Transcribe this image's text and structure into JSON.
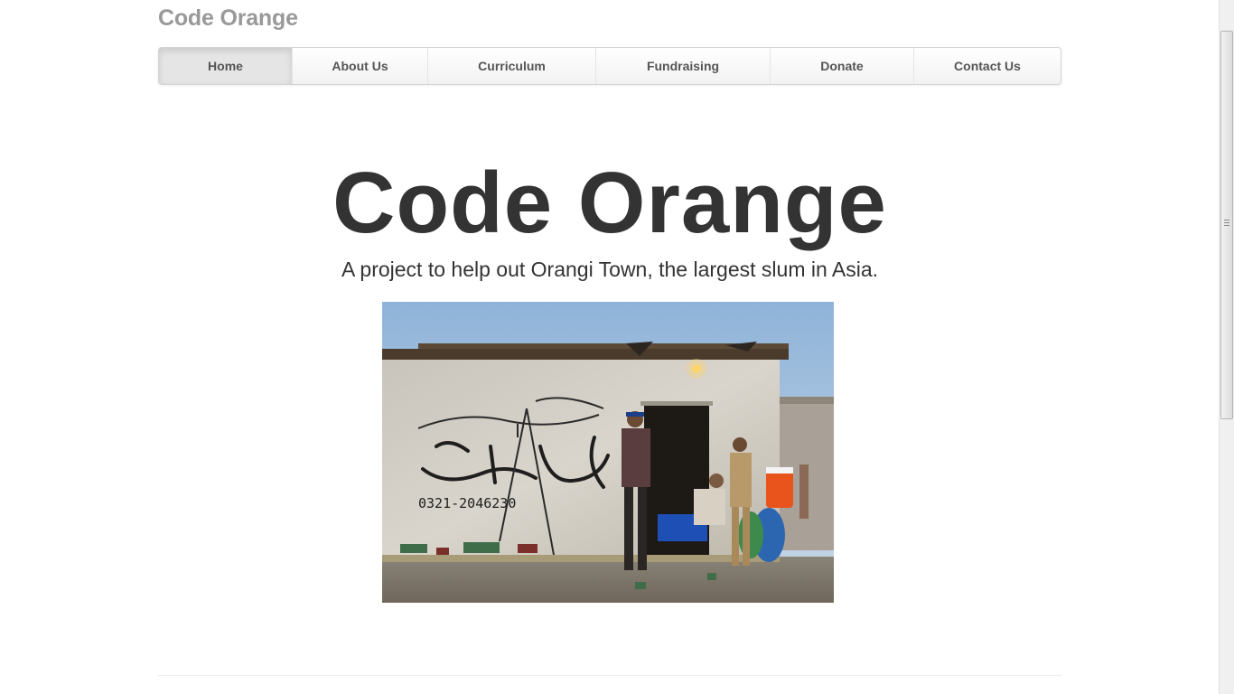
{
  "brand": {
    "title": "Code Orange"
  },
  "nav": {
    "items": [
      {
        "label": "Home",
        "active": true
      },
      {
        "label": "About Us",
        "active": false
      },
      {
        "label": "Curriculum",
        "active": false
      },
      {
        "label": "Fundraising",
        "active": false
      },
      {
        "label": "Donate",
        "active": false
      },
      {
        "label": "Contact Us",
        "active": false
      }
    ]
  },
  "hero": {
    "title": "Code Orange",
    "subtitle": "A project to help out Orangi Town, the largest slum in Asia.",
    "image": {
      "wall_text_phone": "0321-2046230"
    }
  },
  "colors": {
    "brand_text": "#999999",
    "heading_text": "#333333",
    "nav_text": "#555555",
    "nav_active_bg": "#e5e5e5",
    "nav_border": "#d4d4d4"
  }
}
